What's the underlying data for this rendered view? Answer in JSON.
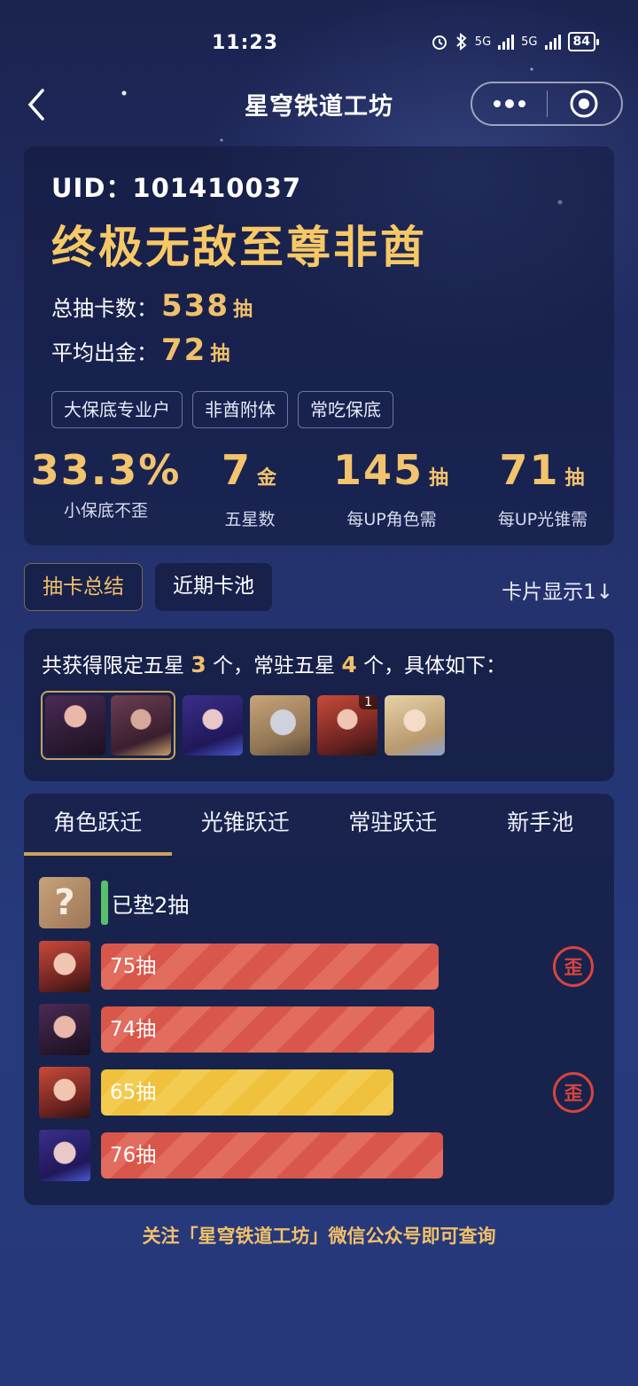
{
  "status_bar": {
    "time": "11:23",
    "battery": "84",
    "net1": "5G",
    "net2": "5G"
  },
  "nav": {
    "title": "星穹铁道工坊"
  },
  "summary": {
    "uid": "UID：101410037",
    "rank_title": "终极无敌至尊非酋",
    "total_label": "总抽卡数：",
    "total_value": "538",
    "total_unit": "抽",
    "avg_label": "平均出金：",
    "avg_value": "72",
    "avg_unit": "抽",
    "tags": [
      "大保底专业户",
      "非酋附体",
      "常吃保底"
    ],
    "metrics": [
      {
        "value": "33.3%",
        "unit": "",
        "label": "小保底不歪"
      },
      {
        "value": "7",
        "unit": "金",
        "label": "五星数"
      },
      {
        "value": "145",
        "unit": "抽",
        "label": "每UP角色需"
      },
      {
        "value": "71",
        "unit": "抽",
        "label": "每UP光锥需"
      }
    ]
  },
  "subtabs": {
    "summary_label": "抽卡总结",
    "recent_label": "近期卡池",
    "display_toggle": "卡片显示1↓"
  },
  "limited": {
    "prefix": "共获得限定五星",
    "limited_count": "3",
    "mid": "个，常驻五星",
    "standard_count": "4",
    "suffix": "个，具体如下：",
    "avatar_badge": "1"
  },
  "history": {
    "tabs": [
      "角色跃迁",
      "光锥跃迁",
      "常驻跃迁",
      "新手池"
    ],
    "pending_question": "?",
    "pending_text": "已垫2抽",
    "wai_label": "歪",
    "rows": [
      {
        "label": "75抽",
        "pulls": 75,
        "gold": false,
        "off": true
      },
      {
        "label": "74抽",
        "pulls": 74,
        "gold": false,
        "off": false
      },
      {
        "label": "65抽",
        "pulls": 65,
        "gold": true,
        "off": true
      },
      {
        "label": "76抽",
        "pulls": 76,
        "gold": false,
        "off": false
      }
    ]
  },
  "footer": {
    "text": "关注「星穹铁道工坊」微信公众号即可查询"
  },
  "colors": {
    "gold": "#f0c06a",
    "red_bar": "#d9574a",
    "yellow_bar": "#f0c13c",
    "wai_red": "#d8453c",
    "pending_green": "#58c06a"
  }
}
